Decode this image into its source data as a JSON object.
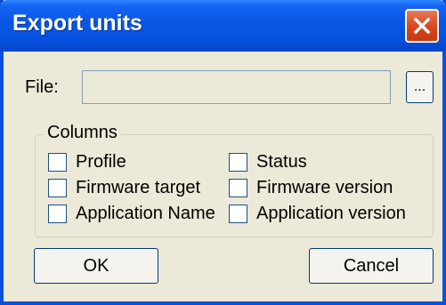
{
  "window": {
    "title": "Export units"
  },
  "file": {
    "label": "File:",
    "value": "",
    "browse_label": "..."
  },
  "columns": {
    "legend": "Columns",
    "left": [
      {
        "label": "Profile",
        "checked": false
      },
      {
        "label": "Firmware target",
        "checked": false
      },
      {
        "label": "Application Name",
        "checked": false
      }
    ],
    "right": [
      {
        "label": "Status",
        "checked": false
      },
      {
        "label": "Firmware version",
        "checked": false
      },
      {
        "label": "Application version",
        "checked": false
      }
    ]
  },
  "buttons": {
    "ok": "OK",
    "cancel": "Cancel"
  },
  "colors": {
    "titlebar": "#0a56e4",
    "close": "#d9441d",
    "face": "#ece9d8"
  },
  "icons": {
    "close": "close-icon"
  }
}
